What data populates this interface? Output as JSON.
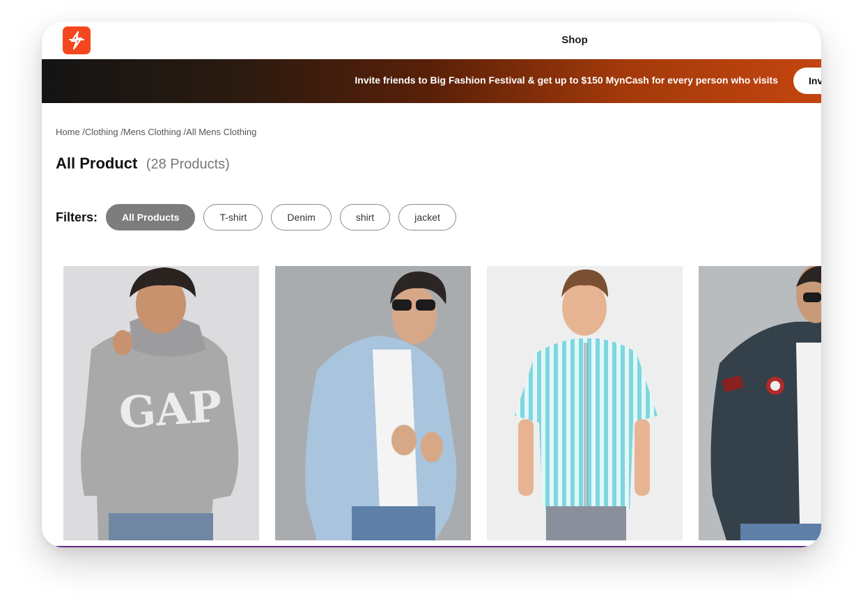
{
  "appbar": {
    "title": "Shop",
    "logo_icon": "lightning-logo-icon",
    "logo_color": "#f5471f"
  },
  "banner": {
    "text": "Invite friends to Big Fashion Festival & get up to $150 MynCash for every person who visits",
    "button_label": "Inv"
  },
  "breadcrumb": "Home /Clothing /Mens Clothing /All Mens Clothing",
  "heading": {
    "title": "All Product",
    "count": "(28 Products)"
  },
  "filters": {
    "label": "Filters:",
    "chips": [
      {
        "label": "All Products",
        "active": true
      },
      {
        "label": "T-shirt",
        "active": false
      },
      {
        "label": "Denim",
        "active": false
      },
      {
        "label": "shirt",
        "active": false
      },
      {
        "label": "jacket",
        "active": false
      }
    ]
  },
  "products": [
    {
      "image": "grey-gap-hoodie-photo",
      "background": "#dcdcdf"
    },
    {
      "image": "light-blue-denim-jacket-photo",
      "background": "#a9acaf"
    },
    {
      "image": "striped-aqua-shirt-photo",
      "background": "#eeeeee"
    },
    {
      "image": "dark-leather-jacket-photo",
      "background": "#b8bcbf"
    }
  ]
}
